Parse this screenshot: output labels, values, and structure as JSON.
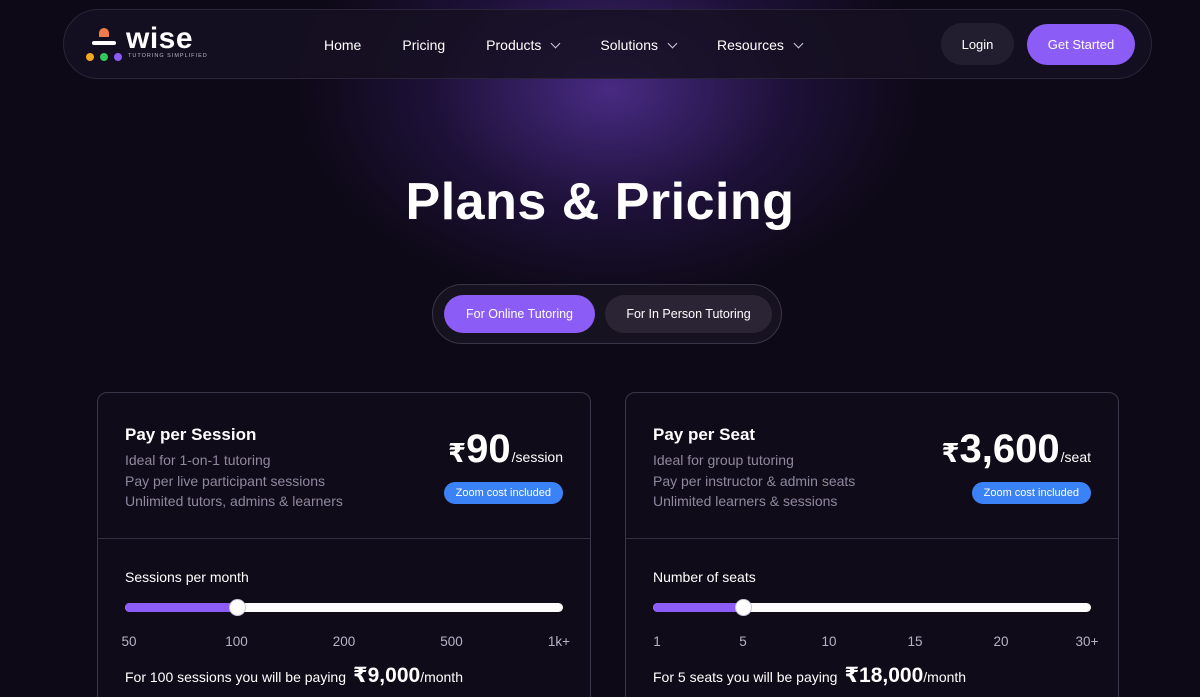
{
  "brand": {
    "name": "wise",
    "tagline": "TUTORING SIMPLIFIED",
    "colors": {
      "head": "#f07a4a",
      "dot1": "#f5a623",
      "dot2": "#34c759",
      "dot3": "#8b5cf6"
    }
  },
  "nav": {
    "items": [
      {
        "label": "Home",
        "dropdown": false
      },
      {
        "label": "Pricing",
        "dropdown": false
      },
      {
        "label": "Products",
        "dropdown": true
      },
      {
        "label": "Solutions",
        "dropdown": true
      },
      {
        "label": "Resources",
        "dropdown": true
      }
    ],
    "login_label": "Login",
    "cta_label": "Get Started"
  },
  "title": "Plans & Pricing",
  "toggle": {
    "options": [
      "For Online Tutoring",
      "For In Person Tutoring"
    ],
    "selected": "For Online Tutoring"
  },
  "colors": {
    "accent": "#8b5cf6",
    "badge": "#3b82f6",
    "background": "#0d0916"
  },
  "plans": [
    {
      "title": "Pay per Session",
      "features": [
        "Ideal for 1-on-1 tutoring",
        "Pay per live participant sessions",
        "Unlimited tutors, admins & learners"
      ],
      "currency": "₹",
      "price": "90",
      "unit": "/session",
      "badge": "Zoom cost included",
      "slider_label": "Sessions per month",
      "ticks": [
        "50",
        "100",
        "200",
        "500",
        "1k+"
      ],
      "selected_tick_index": 1,
      "summary_prefix": "For 100 sessions you will be paying",
      "summary_amount": "₹9,000",
      "summary_unit": "/month"
    },
    {
      "title": "Pay per Seat",
      "features": [
        "Ideal for group tutoring",
        "Pay per instructor & admin seats",
        "Unlimited learners & sessions"
      ],
      "currency": "₹",
      "price": "3,600",
      "unit": "/seat",
      "badge": "Zoom cost included",
      "slider_label": "Number of seats",
      "ticks": [
        "1",
        "5",
        "10",
        "15",
        "20",
        "30+"
      ],
      "selected_tick_index": 1,
      "summary_prefix": "For 5 seats you will be paying",
      "summary_amount": "₹18,000",
      "summary_unit": "/month"
    }
  ]
}
